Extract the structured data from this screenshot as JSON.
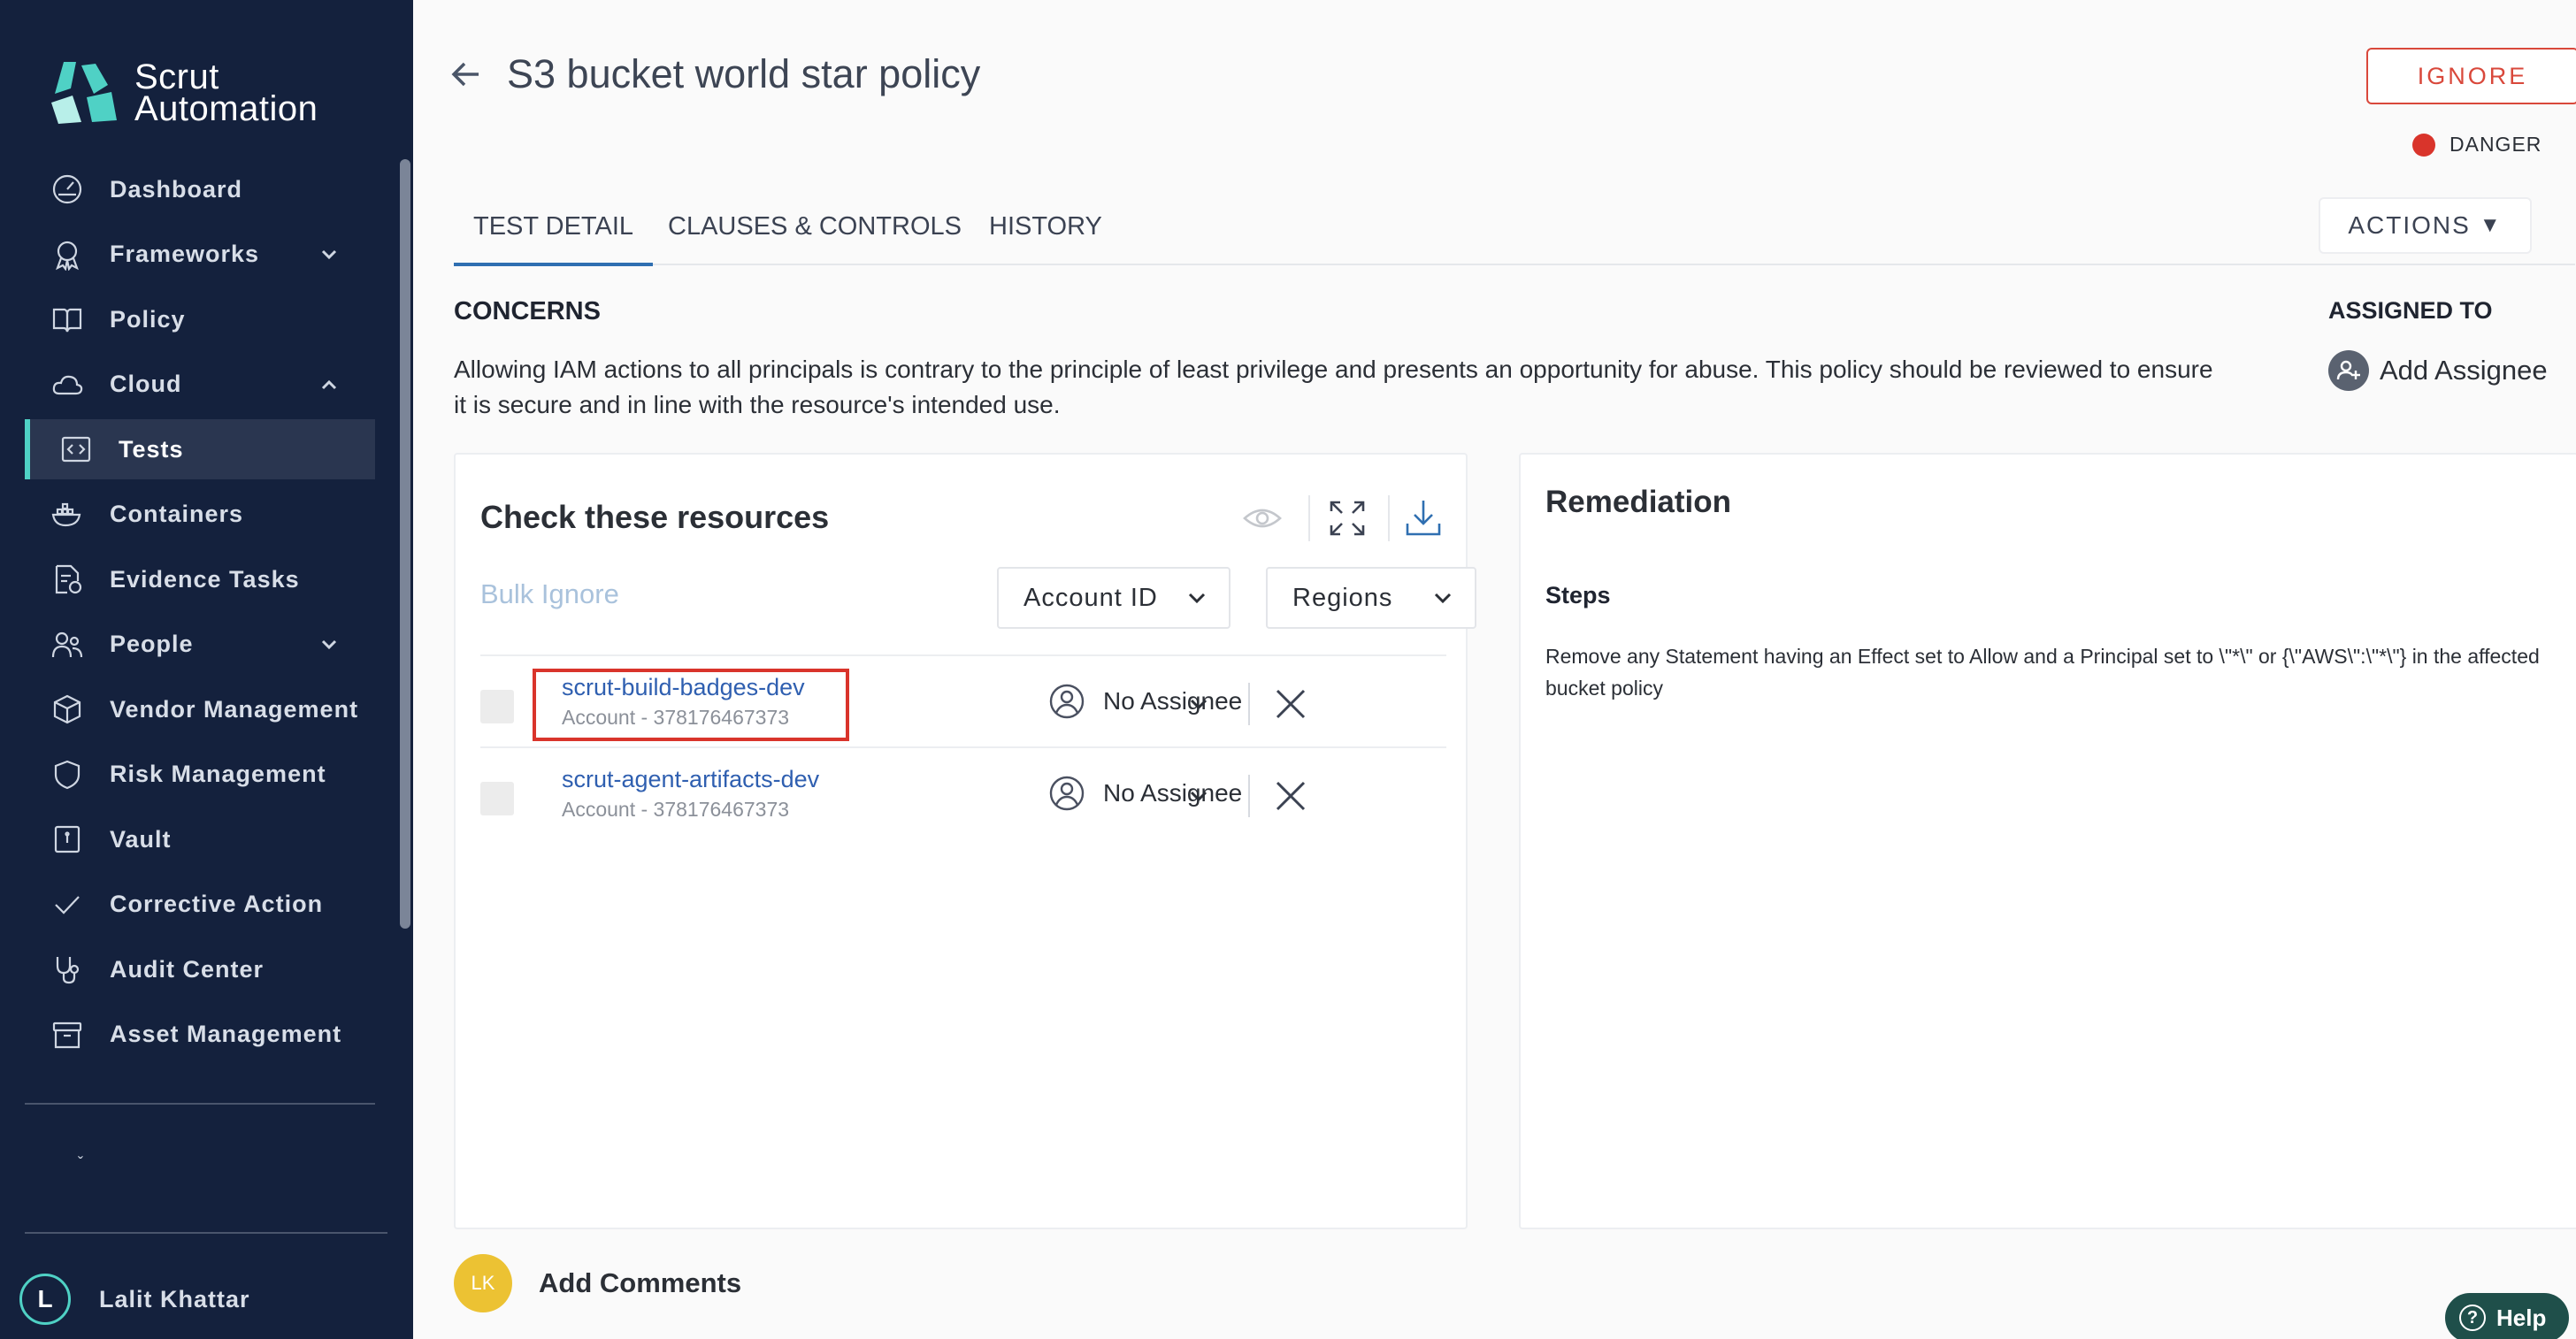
{
  "brand": {
    "name_line1": "Scrut",
    "name_line2": "Automation",
    "accent": "#4fd1c5",
    "sidebar_bg": "#14213d"
  },
  "sidebar": {
    "items": [
      {
        "label": "Dashboard",
        "icon": "dashboard-icon",
        "chevron": ""
      },
      {
        "label": "Frameworks",
        "icon": "award-icon",
        "chevron": "down"
      },
      {
        "label": "Policy",
        "icon": "book-icon",
        "chevron": ""
      },
      {
        "label": "Cloud",
        "icon": "cloud-icon",
        "chevron": "up"
      },
      {
        "label": "Tests",
        "icon": "code-icon",
        "chevron": "",
        "active": true
      },
      {
        "label": "Containers",
        "icon": "docker-icon",
        "chevron": ""
      },
      {
        "label": "Evidence Tasks",
        "icon": "file-check-icon",
        "chevron": ""
      },
      {
        "label": "People",
        "icon": "people-icon",
        "chevron": "down"
      },
      {
        "label": "Vendor Management",
        "icon": "box-icon",
        "chevron": ""
      },
      {
        "label": "Risk Management",
        "icon": "shield-icon",
        "chevron": ""
      },
      {
        "label": "Vault",
        "icon": "vault-icon",
        "chevron": ""
      },
      {
        "label": "Corrective Action",
        "icon": "check-icon",
        "chevron": ""
      },
      {
        "label": "Audit Center",
        "icon": "stethoscope-icon",
        "chevron": ""
      },
      {
        "label": "Asset Management",
        "icon": "archive-icon",
        "chevron": ""
      }
    ],
    "user": {
      "initial": "L",
      "name": "Lalit Khattar"
    }
  },
  "header": {
    "title": "S3 bucket world star policy",
    "ignore_label": "IGNORE",
    "severity": {
      "label": "DANGER",
      "color": "#d9342b"
    }
  },
  "tabs": [
    {
      "label": "TEST DETAIL",
      "active": true
    },
    {
      "label": "CLAUSES & CONTROLS",
      "active": false
    },
    {
      "label": "HISTORY",
      "active": false
    }
  ],
  "actions_label": "ACTIONS",
  "concerns": {
    "heading": "CONCERNS",
    "text": "Allowing IAM actions to all principals is contrary to the principle of least privilege and presents an opportunity for abuse. This policy should be reviewed to ensure it is secure and in line with the resource's intended use."
  },
  "assigned": {
    "heading": "ASSIGNED TO",
    "add_label": "Add Assignee"
  },
  "resources": {
    "title": "Check these resources",
    "bulk_ignore": "Bulk Ignore",
    "filter_account": "Account ID",
    "filter_regions": "Regions",
    "rows": [
      {
        "name": "scrut-build-badges-dev",
        "account": "Account - 378176467373",
        "assignee": "No Assignee"
      },
      {
        "name": "scrut-agent-artifacts-dev",
        "account": "Account - 378176467373",
        "assignee": "No Assignee"
      }
    ]
  },
  "remediation": {
    "title": "Remediation",
    "steps_heading": "Steps",
    "steps_text": "Remove any Statement having an Effect set to Allow and a Principal set to \\\"*\\\" or {\\\"AWS\\\":\\\"*\\\"} in the affected bucket policy"
  },
  "comments": {
    "initials": "LK",
    "label": "Add Comments"
  },
  "help_label": "Help"
}
